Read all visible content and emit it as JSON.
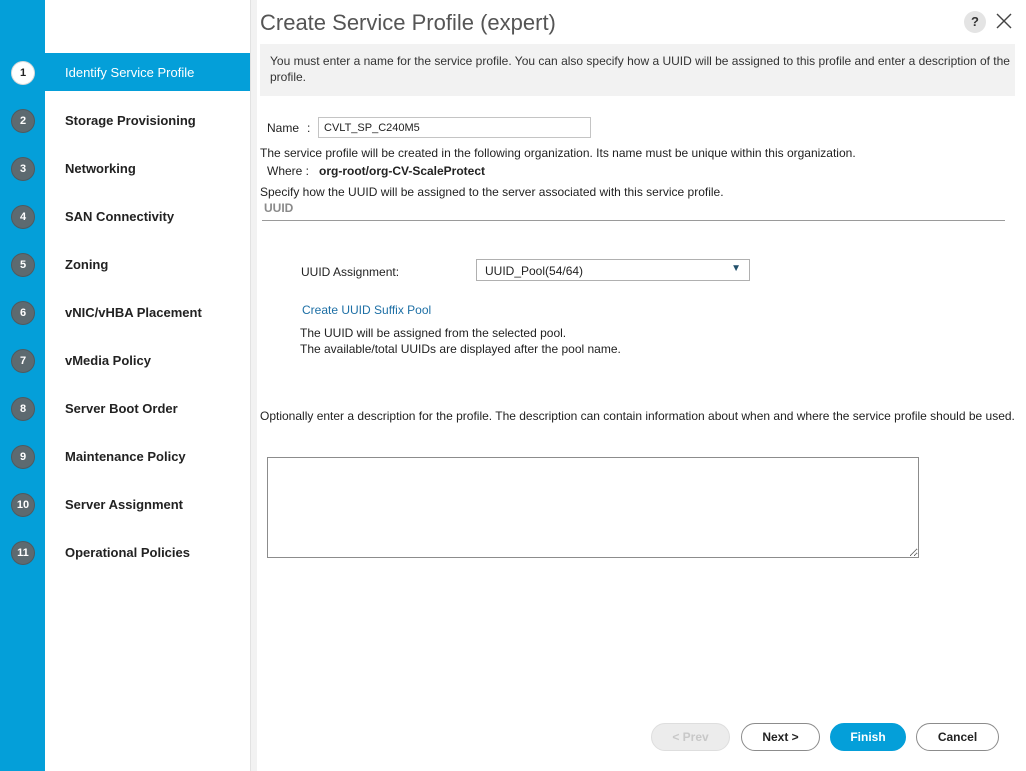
{
  "header": {
    "title": "Create Service Profile (expert)",
    "help_label": "?",
    "help_icon": "question-icon",
    "close_icon": "close-icon"
  },
  "intro": {
    "text": "You must enter a name for the service profile. You can also specify how a UUID will be assigned to this profile and enter a description of the profile."
  },
  "steps": [
    {
      "num": "1",
      "label": "Identify Service Profile",
      "active": true
    },
    {
      "num": "2",
      "label": "Storage Provisioning",
      "active": false
    },
    {
      "num": "3",
      "label": "Networking",
      "active": false
    },
    {
      "num": "4",
      "label": "SAN Connectivity",
      "active": false
    },
    {
      "num": "5",
      "label": "Zoning",
      "active": false
    },
    {
      "num": "6",
      "label": "vNIC/vHBA Placement",
      "active": false
    },
    {
      "num": "7",
      "label": "vMedia Policy",
      "active": false
    },
    {
      "num": "8",
      "label": "Server Boot Order",
      "active": false
    },
    {
      "num": "9",
      "label": "Maintenance Policy",
      "active": false
    },
    {
      "num": "10",
      "label": "Server Assignment",
      "active": false
    },
    {
      "num": "11",
      "label": "Operational Policies",
      "active": false
    }
  ],
  "form": {
    "name_label": "Name",
    "name_sep": ":",
    "name_value": "CVLT_SP_C240M5",
    "org_note": "The service profile will be created in the following organization. Its name must be unique within this organization.",
    "where_label": "Where :",
    "where_value": "org-root/org-CV-ScaleProtect",
    "uuid_note": "Specify how the UUID will be assigned to the server associated with this service profile.",
    "uuid_section": "UUID",
    "uuid_assignment_label": "UUID Assignment:",
    "uuid_assignment_value": "UUID_Pool(54/64)",
    "create_pool_link": "Create UUID Suffix Pool",
    "pool_note_1": "The UUID will be assigned from the selected pool.",
    "pool_note_2": "The available/total UUIDs are displayed after the pool name.",
    "desc_prompt": "Optionally enter a description for the profile. The description can contain information about when and where the service profile should be used.",
    "desc_value": ""
  },
  "buttons": {
    "prev": "< Prev",
    "next": "Next >",
    "finish": "Finish",
    "cancel": "Cancel"
  },
  "colors": {
    "accent": "#049fd9",
    "step_badge": "#5d6a70",
    "link": "#1d6fa5"
  }
}
